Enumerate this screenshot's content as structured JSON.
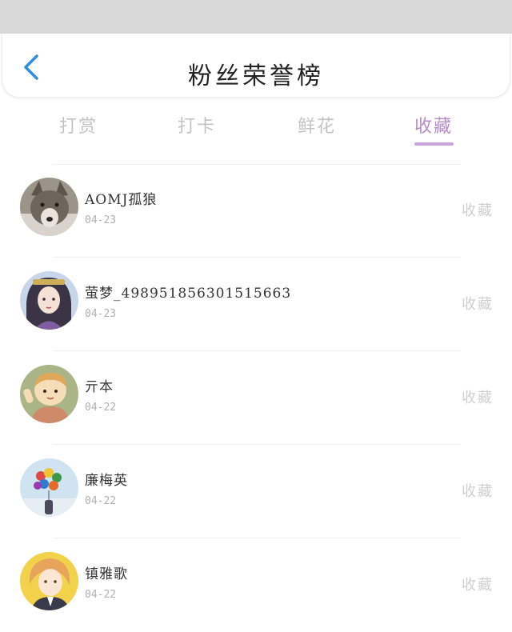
{
  "header": {
    "title": "粉丝荣誉榜",
    "back_icon": "chevron-left-icon"
  },
  "tabs": [
    {
      "label": "打赏",
      "active": false
    },
    {
      "label": "打卡",
      "active": false
    },
    {
      "label": "鲜花",
      "active": false
    },
    {
      "label": "收藏",
      "active": true
    }
  ],
  "list": {
    "items": [
      {
        "name": "AOMJ孤狼",
        "date": "04-23",
        "action": "收藏",
        "avatar": "wolf-avatar"
      },
      {
        "name": "萤梦_498951856301515663",
        "date": "04-23",
        "action": "收藏",
        "avatar": "girl-avatar"
      },
      {
        "name": "亓本",
        "date": "04-22",
        "action": "收藏",
        "avatar": "cartoon-boy-avatar"
      },
      {
        "name": "廉梅英",
        "date": "04-22",
        "action": "收藏",
        "avatar": "balloons-avatar"
      },
      {
        "name": "镇雅歌",
        "date": "04-22",
        "action": "收藏",
        "avatar": "anime-avatar"
      }
    ]
  },
  "colors": {
    "accent": "#b48cc8",
    "indicator": "#c8a6da",
    "back_icon": "#2c8ddc",
    "inactive_text": "#c4c4c4"
  }
}
